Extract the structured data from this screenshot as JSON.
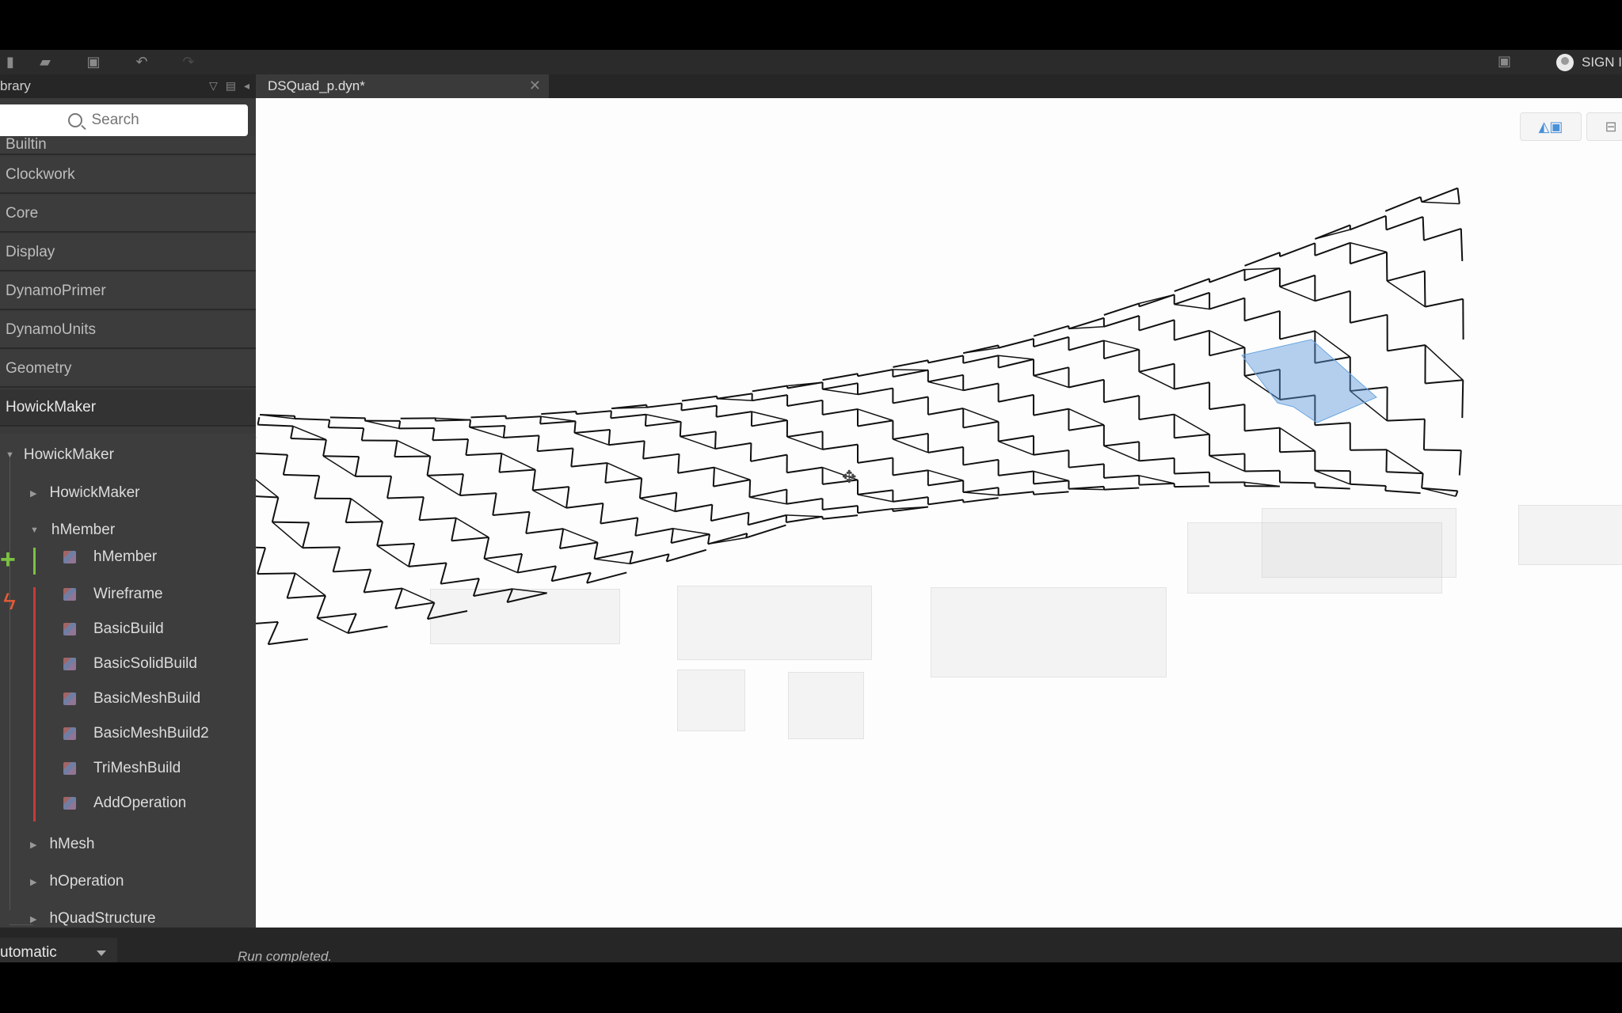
{
  "library": {
    "title": "brary",
    "search_placeholder": "Search",
    "categories": [
      "Builtin",
      "Clockwork",
      "Core",
      "Display",
      "DynamoPrimer",
      "DynamoUnits",
      "Geometry",
      "HowickMaker"
    ],
    "expanded": {
      "root": "HowickMaker",
      "children": [
        "HowickMaker",
        "hMember"
      ],
      "hmember_items": [
        "hMember",
        "Wireframe",
        "BasicBuild",
        "BasicSolidBuild",
        "BasicMeshBuild",
        "BasicMeshBuild2",
        "TriMeshBuild",
        "AddOperation"
      ],
      "more": [
        "hMesh",
        "hOperation",
        "hQuadStructure"
      ]
    }
  },
  "tab": {
    "label": "DSQuad_p.dyn*"
  },
  "header": {
    "sign_in": "SIGN I"
  },
  "status": {
    "run_mode": "utomatic",
    "message": "Run completed."
  },
  "colors": {
    "panel": "#3a3a3a",
    "canvas": "#fdfdfd",
    "accent_blue": "#4a90d9",
    "add_green": "#7cc242",
    "bolt_red": "#e25b37"
  }
}
